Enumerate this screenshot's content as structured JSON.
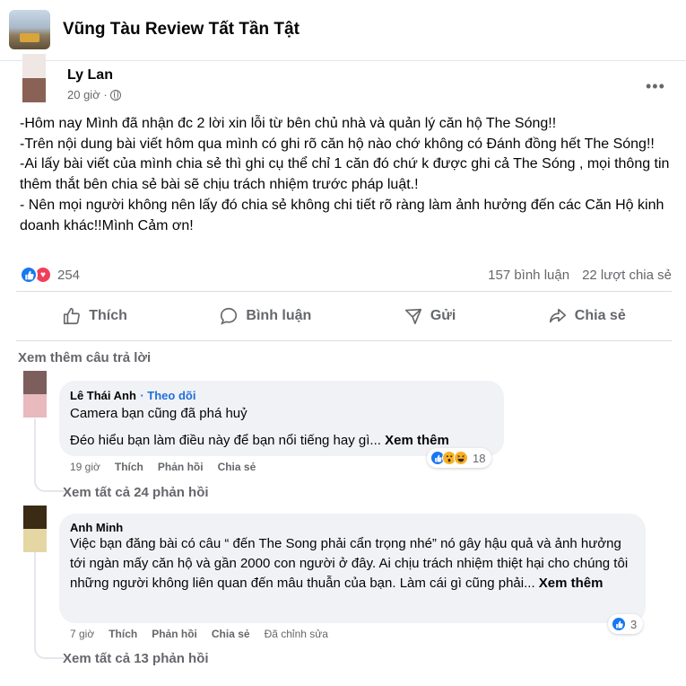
{
  "group": {
    "name": "Vũng Tàu Review Tất Tần Tật"
  },
  "post": {
    "author": "Ly Lan",
    "time": "20 giờ ·",
    "lines": [
      "-Hôm nay Mình đã nhận đc 2 lời xin lỗi từ bên chủ nhà và quản lý căn hộ The Sóng!!",
      "-Trên nội dung bài viết hôm qua mình có ghi rõ căn hộ nào chớ không có Đánh đồng hết The Sóng!!",
      "-Ai lấy bài viết của mình chia sẻ thì ghi cụ thể chỉ 1 căn đó chứ k được ghi cả The Sóng , mọi thông tin thêm thắt bên chia sẻ bài sẽ chịu trách nhiệm trước pháp luật.!",
      "- Nên mọi người không nên lấy đó chia sẻ không chi tiết rõ ràng làm ảnh hưởng đến các Căn Hộ kinh doanh khác!!Mình Cảm ơn!"
    ],
    "reaction_count": "254",
    "comments_count": "157 bình luận",
    "shares_count": "22 lượt chia sẻ"
  },
  "actions": {
    "like": "Thích",
    "comment": "Bình luận",
    "send": "Gửi",
    "share": "Chia sẻ"
  },
  "see_more_replies": "Xem thêm câu trả lời",
  "comments": [
    {
      "author": "Lê Thái Anh",
      "follow": "· Theo dõi",
      "line1": "Camera bạn cũng đã phá huỷ",
      "line2": "Đéo hiểu bạn làm điều này để bạn nổi tiếng hay gì...",
      "see_more": "Xem thêm",
      "time": "19 giờ",
      "like": "Thích",
      "reply": "Phản hồi",
      "share": "Chia sẻ",
      "reaction_count": "18",
      "view_replies": "Xem tất cả 24 phản hồi"
    },
    {
      "author": "Anh Minh",
      "text": "Việc bạn đăng bài có câu “ đến The Song phải cẩn trọng nhé” nó gây hậu quả và ảnh hưởng tới ngàn mấy căn hộ và gần 2000 con người ở đây. Ai chịu trách nhiệm thiệt hại cho chúng tôi những người không liên quan đến mâu thuẫn của bạn. Làm cái gì cũng phải...",
      "see_more": "Xem thêm",
      "time": "7 giờ",
      "like": "Thích",
      "reply": "Phản hồi",
      "share": "Chia sẻ",
      "edited": "Đã chỉnh sửa",
      "reaction_count": "3",
      "view_replies": "Xem tất cả 13 phản hồi"
    }
  ],
  "colors": {
    "link": "#216fdb",
    "like": "#1877f2",
    "love": "#f33e58",
    "muted": "#65676b",
    "bubble": "#f0f2f5"
  }
}
